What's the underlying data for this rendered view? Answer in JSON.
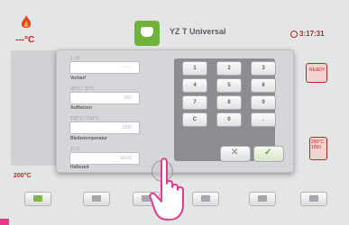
{
  "header": {
    "temperature": "---°C",
    "app_title": "YZ T Universal",
    "clock": "3:17:31"
  },
  "side": {
    "bottom_temperature": "200°C",
    "right_tile_1": "READY",
    "right_tile_2": "200°C 1000"
  },
  "modal": {
    "fields": [
      {
        "label": "1 / 8",
        "caption": "Vorlauf",
        "value": "-- : --"
      },
      {
        "label": "30°C / 30°C",
        "caption": "Aufheizen",
        "value": "100"
      },
      {
        "label": "100°C / 100°C",
        "caption": "Bleibetemperatur",
        "value": "1200"
      },
      {
        "label": "2 / 3",
        "caption": "Haltezeit",
        "value": "00:00"
      }
    ],
    "keypad": [
      "1",
      "2",
      "3",
      "4",
      "5",
      "6",
      "7",
      "8",
      "9",
      "C",
      "0",
      "."
    ],
    "cancel_label": "✕",
    "confirm_label": "✓"
  },
  "colors": {
    "accent_red": "#c4261d",
    "accent_green": "#6fb33a",
    "marker_pink": "#e23d8c"
  },
  "icons": {
    "flame": "flame-icon",
    "app": "chat-bubble-icon",
    "clock": "clock-icon",
    "hand": "hand-pointer-icon"
  }
}
